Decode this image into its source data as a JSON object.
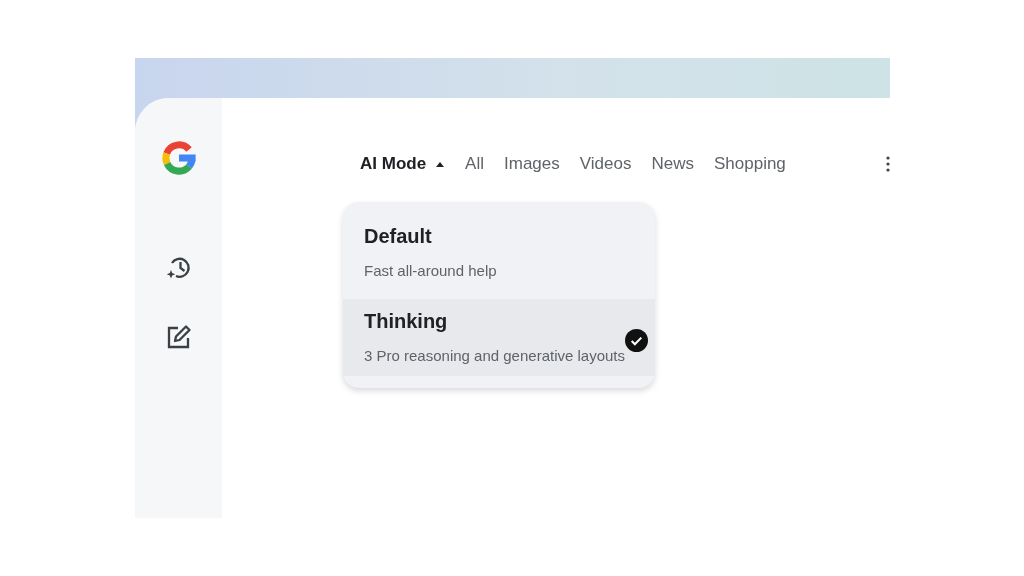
{
  "tabs": [
    {
      "label": "AI Mode",
      "selected": true,
      "kind": "dropdown"
    },
    {
      "label": "All",
      "selected": false,
      "kind": "link"
    },
    {
      "label": "Images",
      "selected": false,
      "kind": "link"
    },
    {
      "label": "Videos",
      "selected": false,
      "kind": "link"
    },
    {
      "label": "News",
      "selected": false,
      "kind": "link"
    },
    {
      "label": "Shopping",
      "selected": false,
      "kind": "link"
    }
  ],
  "mode_menu": {
    "expanded": true,
    "items": [
      {
        "title": "Default",
        "description": "Fast all-around help",
        "selected": false
      },
      {
        "title": "Thinking",
        "description": "3 Pro reasoning and generative layouts",
        "selected": true
      }
    ]
  }
}
